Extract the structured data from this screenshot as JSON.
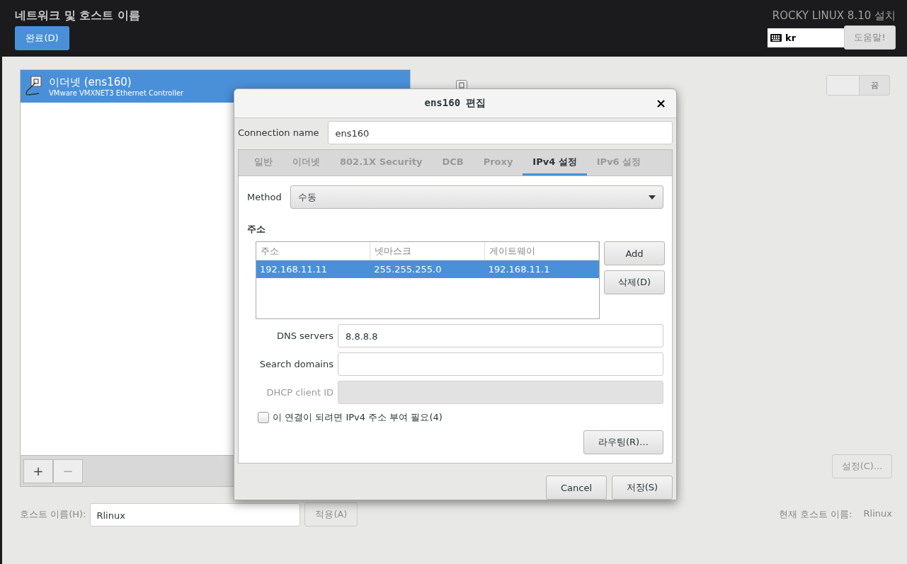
{
  "header": {
    "title": "네트워크 및 호스트 이름",
    "done_button": "완료(D)",
    "product": "ROCKY LINUX 8.10 설치",
    "keyboard_layout": "kr",
    "help_button": "도움말!"
  },
  "devices": [
    {
      "name": "이더넷 (ens160)",
      "description": "VMware VMXNET3 Ethernet Controller",
      "selected": true
    }
  ],
  "device_toolbar": [
    {
      "label": "+",
      "disabled": false
    },
    {
      "label": "−",
      "disabled": true
    }
  ],
  "device_detail": {
    "toggle": {
      "on": false,
      "label": "끔"
    },
    "settings_button": {
      "label": "설정(C)...",
      "disabled": true
    }
  },
  "hostname": {
    "label": "호스트 이름(H):",
    "value": "Rlinux",
    "apply_button": {
      "label": "적용(A)",
      "disabled": true
    },
    "current_label": "현재 호스트 이름:",
    "current_value": "Rlinux"
  },
  "dialog": {
    "title": "ens160 편집",
    "close": "×",
    "connection_name_label": "Connection name",
    "connection_name": "ens160",
    "tabs": [
      {
        "label": "일반",
        "selected": false
      },
      {
        "label": "이더넷",
        "selected": false
      },
      {
        "label": "802.1X Security",
        "selected": false
      },
      {
        "label": "DCB",
        "selected": false
      },
      {
        "label": "Proxy",
        "selected": false
      },
      {
        "label": "IPv4 설정",
        "selected": true
      },
      {
        "label": "IPv6 설정",
        "selected": false
      }
    ],
    "method_label": "Method",
    "method_value": "수동",
    "addresses_heading": "주소",
    "address_columns": [
      "주소",
      "넷마스크",
      "게이트웨이"
    ],
    "address_rows": [
      {
        "cells": [
          "192.168.11.11",
          "255.255.255.0",
          "192.168.11.1"
        ],
        "selected": true
      }
    ],
    "add_button": "Add",
    "delete_button": "삭제(D)",
    "fields": [
      {
        "label": "DNS servers",
        "value": "8.8.8.8",
        "disabled": false
      },
      {
        "label": "Search domains",
        "disabled": false
      },
      {
        "label": "DHCP client ID",
        "disabled": true
      }
    ],
    "require_ipv4": {
      "label": "이 연결이 되려면 IPv4 주소 부여 필요(4)",
      "checked": false
    },
    "routes_button": "라우팅(R)…",
    "cancel_button": "Cancel",
    "save_button": "저장(S)"
  }
}
